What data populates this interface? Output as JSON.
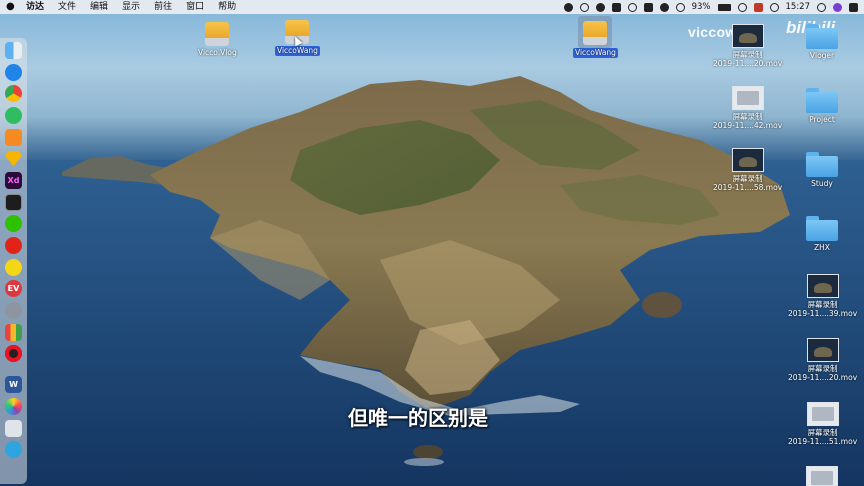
{
  "menubar": {
    "app_name": "访达",
    "items": [
      "文件",
      "编辑",
      "显示",
      "前往",
      "窗口",
      "帮助"
    ],
    "battery": "93%",
    "time": "15:27"
  },
  "watermark": {
    "text": "viccowang",
    "logo": "bilibili"
  },
  "desktop": {
    "drives": [
      {
        "label": "Vicco.Vlog",
        "selected": false
      },
      {
        "label": "ViccoWang",
        "selected": true
      },
      {
        "label": "ViccoWang",
        "selected": true
      }
    ],
    "files": [
      {
        "name": "屏幕录制",
        "sub": "2019-11....20.mov"
      },
      {
        "name": "屏幕录制",
        "sub": "2019-11....42.mov"
      },
      {
        "name": "屏幕录制",
        "sub": "2019-11....58.mov"
      },
      {
        "name": "屏幕录制",
        "sub": "2019-11....39.mov"
      },
      {
        "name": "屏幕录制",
        "sub": "2019-11....20.mov"
      },
      {
        "name": "屏幕录制",
        "sub": "2019-11....51.mov"
      }
    ],
    "folders": [
      "Vloger",
      "Project",
      "Study",
      "ZHX"
    ]
  },
  "subtitle": "但唯一的区别是",
  "dock": {
    "icons": [
      "finder-icon",
      "safari-icon",
      "chrome-icon",
      "evernote-icon",
      "sublime-icon",
      "sketch-icon",
      "xd-icon",
      "terminal-icon",
      "wechat-icon",
      "netease-music-icon",
      "qq-music-icon",
      "expressvpn-icon",
      "rocket-icon",
      "app-grid-icon",
      "record-icon",
      "word-icon",
      "photos-icon",
      "preview-icon",
      "telegram-icon"
    ],
    "xd_label": "Xd",
    "ev_label": "EV",
    "word_label": "W"
  },
  "colors": {
    "selection": "#2f63d8",
    "folder": "#5fb3ec",
    "drive": "#f0b133"
  }
}
